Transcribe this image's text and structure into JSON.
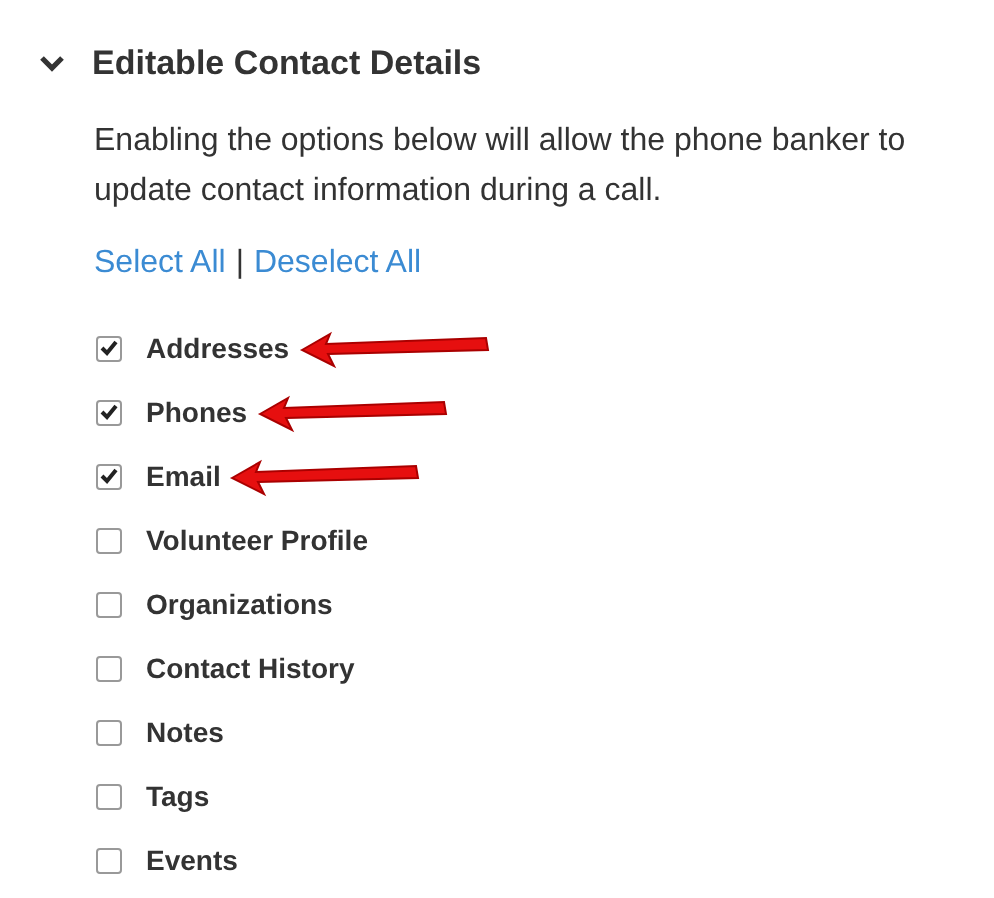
{
  "section": {
    "title": "Editable Contact Details",
    "expanded": true,
    "description": "Enabling the options below will allow the phone banker to update contact information during a call.",
    "links": [
      "Select All",
      "|",
      "Deselect All"
    ],
    "options": [
      {
        "label": "Addresses",
        "checked": true,
        "annotated": true
      },
      {
        "label": "Phones",
        "checked": true,
        "annotated": true
      },
      {
        "label": "Email",
        "checked": true,
        "annotated": true
      },
      {
        "label": "Volunteer Profile",
        "checked": false,
        "annotated": false
      },
      {
        "label": "Organizations",
        "checked": false,
        "annotated": false
      },
      {
        "label": "Contact History",
        "checked": false,
        "annotated": false
      },
      {
        "label": "Notes",
        "checked": false,
        "annotated": false
      },
      {
        "label": "Tags",
        "checked": false,
        "annotated": false
      },
      {
        "label": "Events",
        "checked": false,
        "annotated": false
      }
    ]
  }
}
